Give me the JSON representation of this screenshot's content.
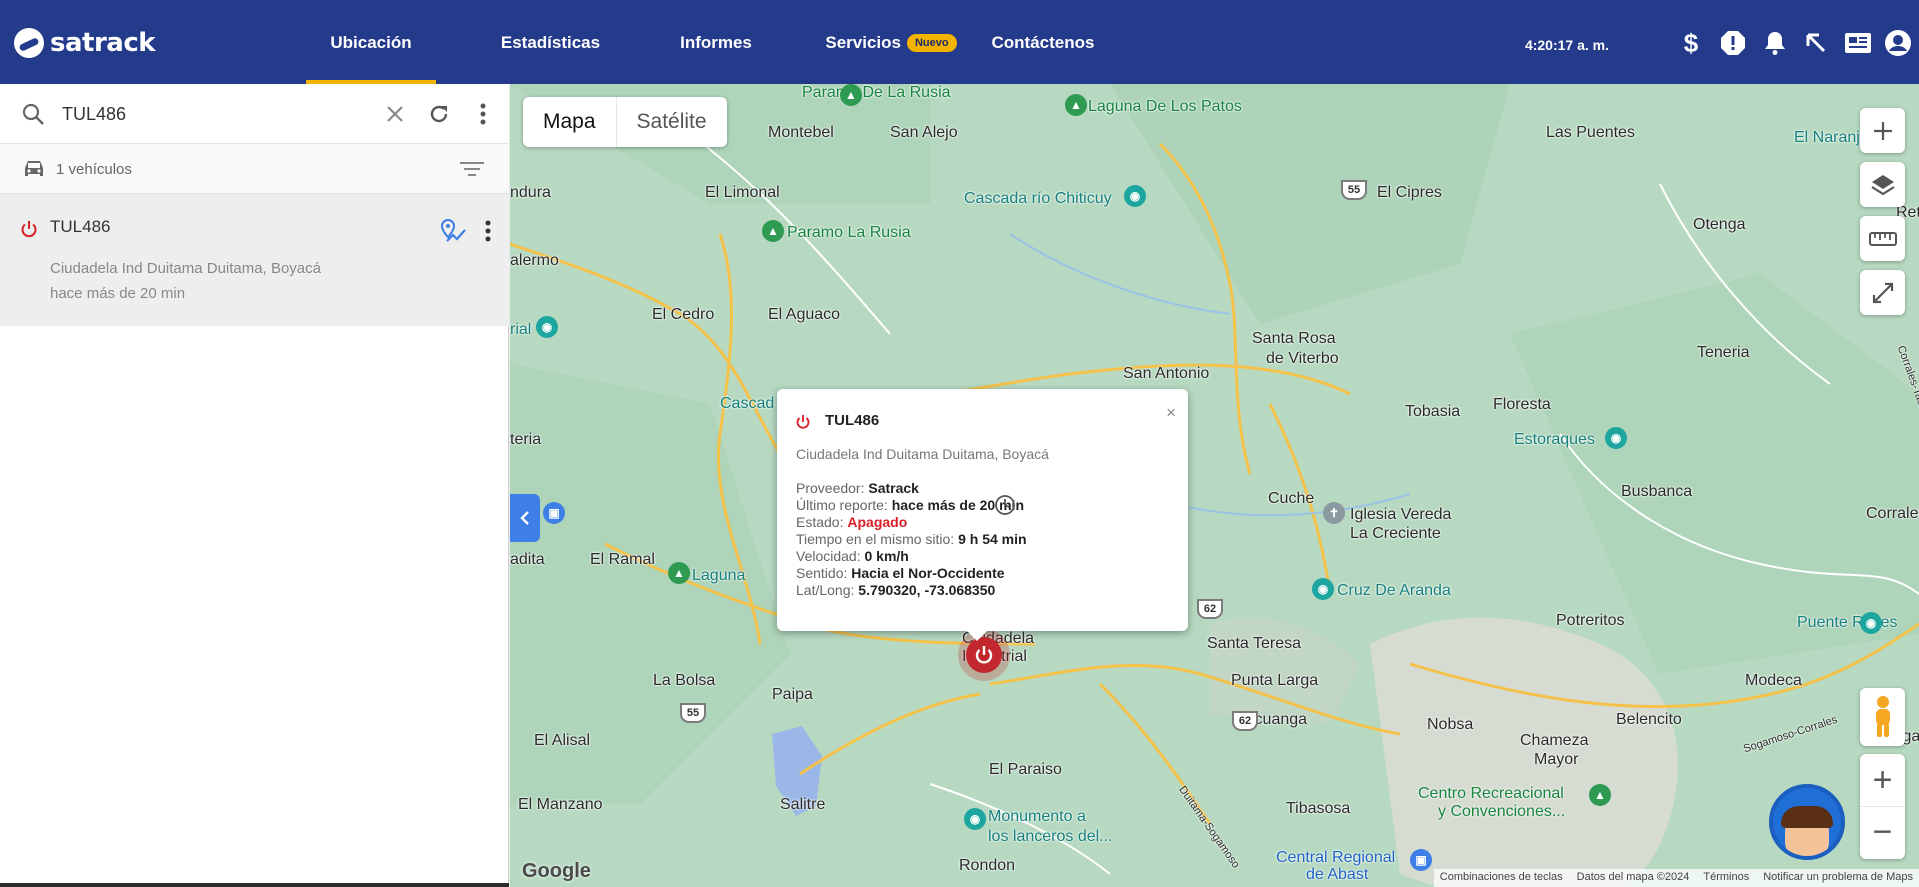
{
  "brand": {
    "name": "satrack"
  },
  "nav": {
    "items": [
      {
        "label": "Ubicación",
        "active": true
      },
      {
        "label": "Estadísticas",
        "active": false
      },
      {
        "label": "Informes",
        "active": false
      },
      {
        "label": "Servicios",
        "active": false,
        "badge": "Nuevo"
      },
      {
        "label": "Contáctenos",
        "active": false
      }
    ],
    "clock": "4:20:17 a. m.",
    "icons": [
      "dollar-icon",
      "alert-icon",
      "bell-icon",
      "pointer-icon",
      "news-icon",
      "account-icon"
    ]
  },
  "sidebar": {
    "search": {
      "value": "TUL486",
      "placeholder": ""
    },
    "vehicle_count": "1 vehículos",
    "vehicles": [
      {
        "plate": "TUL486",
        "location": "Ciudadela Ind Duitama Duitama, Boyacá",
        "last_report": "hace más de 20 min"
      }
    ]
  },
  "map": {
    "type_buttons": [
      "Mapa",
      "Satélite"
    ],
    "selected_type": "Mapa",
    "places": [
      "Paramo De La Rusia",
      "Laguna De Los Patos",
      "Montebel",
      "San Alejo",
      "Las Puentes",
      "El Naranj",
      "ndura",
      "El Limonal",
      "Cascada río Chiticuy",
      "El Cipres",
      "Otenga",
      "Ret",
      "alermo",
      "Paramo La Rusia",
      "El Cedro",
      "El Aguaco",
      "Teneria",
      "rial",
      "Santa Rosa",
      "de Viterbo",
      "San Antonio",
      "Cascad",
      "Tobasia",
      "Floresta",
      "teria",
      "Estoraques",
      "Cuche",
      "Iglesia Vereda",
      "La Creciente",
      "Busbanca",
      "Corrales",
      "adita",
      "El Ramal",
      "Laguna",
      "Cruz De Aranda",
      "Potreritos",
      "Puente Reyes",
      "Ciudadela",
      "Industrial",
      "Santa Teresa",
      "La Bolsa",
      "Paipa",
      "Punta Larga",
      "Modeca",
      "Ucuanga",
      "Nobsa",
      "Chameza",
      "Mayor",
      "Belencito",
      "Tópaga",
      "El Alisal",
      "El Paraiso",
      "Centro Recreacional",
      "y Convenciones...",
      "El Manzano",
      "Salitre",
      "Tibasosa",
      "Monumento a",
      "los lanceros del...",
      "Rondon",
      "Central Regional",
      "de Abast",
      "Duitama-Sogamoso",
      "Sogamoso-Corrales",
      "Corrales-Tasco"
    ],
    "road_shields": [
      "55",
      "55",
      "62",
      "62"
    ],
    "attribution": {
      "logo": "Google",
      "shortcuts": "Combinaciones de teclas",
      "data": "Datos del mapa ©2024",
      "terms": "Términos",
      "report": "Notificar un problema de Maps"
    }
  },
  "popup": {
    "title": "TUL486",
    "close": "×",
    "address": "Ciudadela Ind Duitama Duitama, Boyacá",
    "rows": [
      {
        "label": "Proveedor: ",
        "value": "Satrack"
      },
      {
        "label": "Último reporte: ",
        "value": "hace más de 20 min"
      },
      {
        "label": "Estado: ",
        "value": "Apagado"
      },
      {
        "label": "Tiempo en el mismo sitio: ",
        "value": "9 h 54 min"
      },
      {
        "label": "Velocidad: ",
        "value": "0 km/h"
      },
      {
        "label": "Sentido: ",
        "value": "Hacia el Nor-Occidente"
      },
      {
        "label": "Lat/Long: ",
        "value": "5.790320, -73.068350"
      }
    ]
  },
  "colors": {
    "nav_bg": "#243a8a",
    "accent_yellow": "#f2b400",
    "status_off_red": "#d81f26",
    "map_green": "#b5d8c0",
    "road_yellow": "#f4c24a"
  }
}
